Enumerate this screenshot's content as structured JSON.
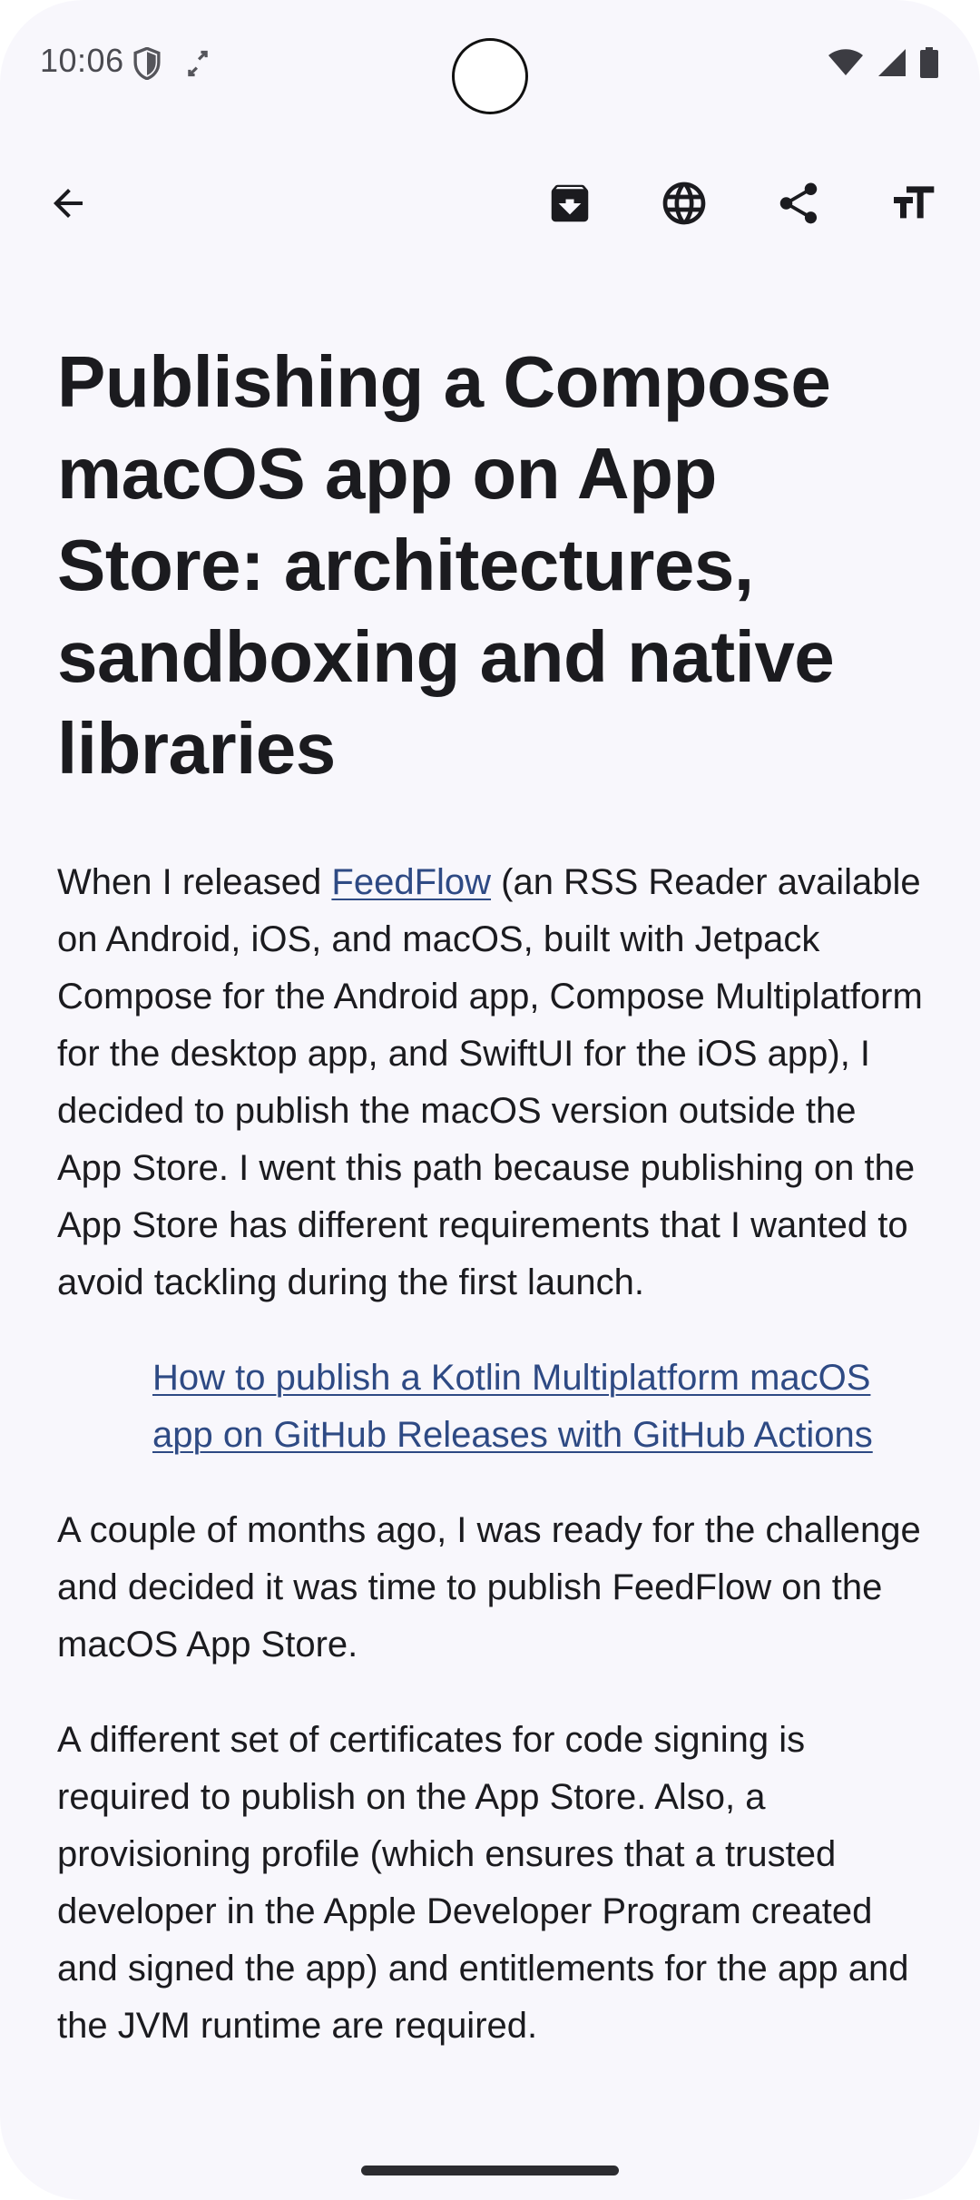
{
  "status_bar": {
    "time": "10:06"
  },
  "toolbar": {
    "back_icon": "arrow-back-icon",
    "archive_icon": "archive-icon",
    "browser_icon": "globe-icon",
    "share_icon": "share-icon",
    "font_size_icon": "text-size-icon"
  },
  "article": {
    "title": "Publishing a Compose macOS app on App Store: architectures, sandboxing and native libraries",
    "p1_before_link": "When I released ",
    "p1_link": "FeedFlow",
    "p1_after_link": " (an RSS Reader available on Android, iOS, and macOS, built with Jetpack Compose for the Android app, Compose Multiplatform for the desktop app, and SwiftUI for the iOS app), I decided to publish the macOS version outside the App Store. I went this path because publishing on the App Store has different requirements that I wanted to avoid tackling during the first launch.",
    "quote_link": "How to publish a Kotlin Multiplatform macOS app on GitHub Releases with GitHub Actions",
    "p2": "A couple of months ago, I was ready for the challenge and decided it was time to publish FeedFlow on the macOS App Store.",
    "p3": "A different set of certificates for code signing is required to publish on the App Store. Also, a provisioning profile (which ensures that a trusted developer in the Apple Developer Program created and signed the app) and entitlements for the app and the JVM runtime are required."
  },
  "colors": {
    "background": "#f8f7fc",
    "text": "#1b1b1f",
    "link": "#2e4a84",
    "icon": "#1b1b1f"
  }
}
